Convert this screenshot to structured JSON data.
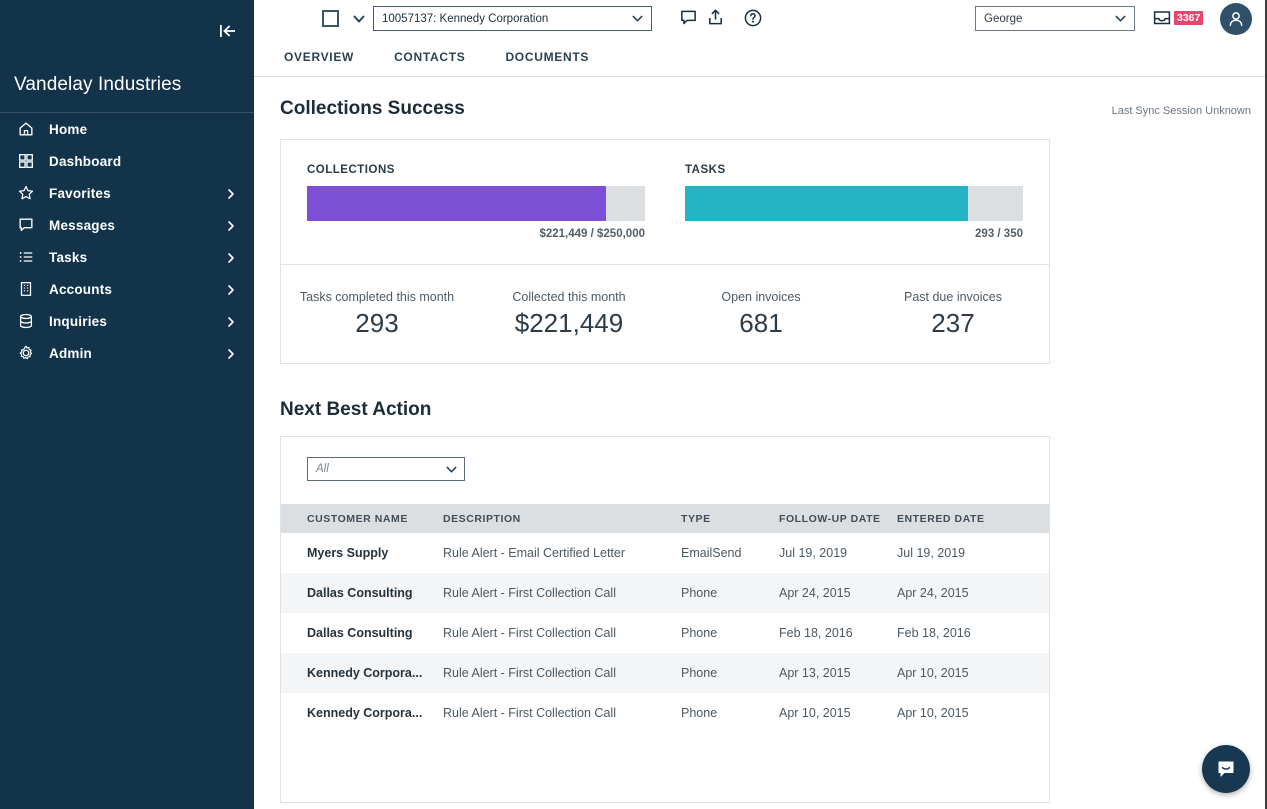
{
  "sidebar": {
    "brand": "Vandelay Industries",
    "collapse_label": "Collapse sidebar",
    "items": [
      {
        "label": "Home",
        "icon": "home-icon",
        "has_chevron": false
      },
      {
        "label": "Dashboard",
        "icon": "dashboard-icon",
        "has_chevron": false
      },
      {
        "label": "Favorites",
        "icon": "star-icon",
        "has_chevron": true
      },
      {
        "label": "Messages",
        "icon": "message-icon",
        "has_chevron": true
      },
      {
        "label": "Tasks",
        "icon": "list-icon",
        "has_chevron": true
      },
      {
        "label": "Accounts",
        "icon": "building-icon",
        "has_chevron": true
      },
      {
        "label": "Inquiries",
        "icon": "database-icon",
        "has_chevron": true
      },
      {
        "label": "Admin",
        "icon": "gear-icon",
        "has_chevron": true
      }
    ]
  },
  "topbar": {
    "account_value": "10057137: Kennedy Corporation",
    "user_value": "George",
    "inbox_badge": "3367",
    "icons": [
      "comment-icon",
      "share-upload-icon",
      "help-circle-icon"
    ]
  },
  "tabs": [
    {
      "label": "OVERVIEW"
    },
    {
      "label": "CONTACTS"
    },
    {
      "label": "DOCUMENTS"
    }
  ],
  "collections": {
    "title": "Collections Success",
    "last_sync": "Last Sync Session Unknown",
    "bars": [
      {
        "label": "COLLECTIONS",
        "value_text": "$221,449 / $250,000",
        "percent": 88.6,
        "color": "#7c4fd4"
      },
      {
        "label": "TASKS",
        "value_text": "293 / 350",
        "percent": 83.7,
        "color": "#24b4c3"
      }
    ],
    "stats": [
      {
        "label": "Tasks completed this month",
        "value": "293"
      },
      {
        "label": "Collected this month",
        "value": "$221,449"
      },
      {
        "label": "Open invoices",
        "value": "681"
      },
      {
        "label": "Past due invoices",
        "value": "237"
      }
    ]
  },
  "next_best_action": {
    "title": "Next Best Action",
    "filter_value": "All",
    "columns": [
      "CUSTOMER NAME",
      "DESCRIPTION",
      "TYPE",
      "FOLLOW-UP DATE",
      "ENTERED DATE"
    ],
    "rows": [
      {
        "customer_name": "Myers Supply",
        "description": "Rule Alert - Email Certified Letter",
        "type": "EmailSend",
        "follow_up_date": "Jul 19, 2019",
        "entered_date": "Jul 19, 2019"
      },
      {
        "customer_name": "Dallas Consulting",
        "description": "Rule Alert - First Collection Call",
        "type": "Phone",
        "follow_up_date": "Apr 24, 2015",
        "entered_date": "Apr 24, 2015"
      },
      {
        "customer_name": "Dallas Consulting",
        "description": "Rule Alert - First Collection Call",
        "type": "Phone",
        "follow_up_date": "Feb 18, 2016",
        "entered_date": "Feb 18, 2016"
      },
      {
        "customer_name": "Kennedy Corpora...",
        "description": "Rule Alert - First Collection Call",
        "type": "Phone",
        "follow_up_date": "Apr 13, 2015",
        "entered_date": "Apr 10, 2015"
      },
      {
        "customer_name": "Kennedy Corpora...",
        "description": "Rule Alert - First Collection Call",
        "type": "Phone",
        "follow_up_date": "Apr 10, 2015",
        "entered_date": "Apr 10, 2015"
      }
    ]
  },
  "chat": {
    "icon": "chat-bubble-icon"
  },
  "colors": {
    "sidebar_bg": "#12334a",
    "collections_bar": "#7c4fd4",
    "tasks_bar": "#24b4c3",
    "track": "#dcdfe1",
    "badge": "#e8456f"
  }
}
